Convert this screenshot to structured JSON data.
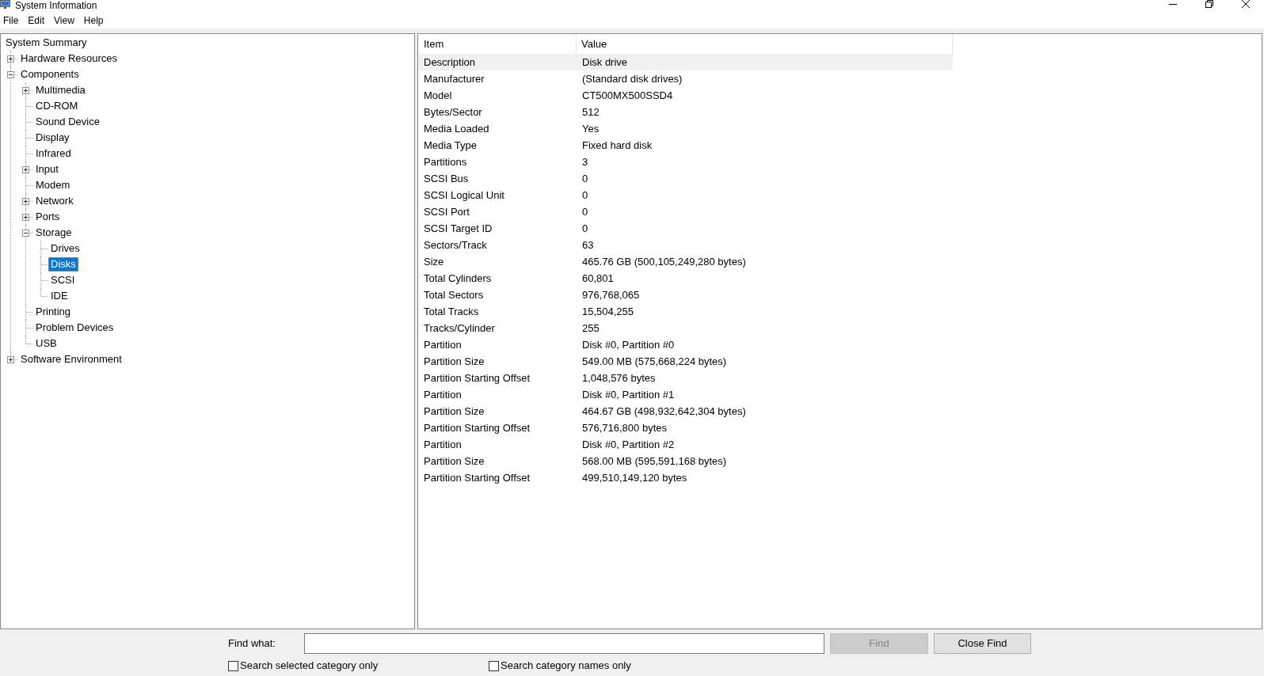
{
  "window": {
    "title": "System Information"
  },
  "menu": [
    "File",
    "Edit",
    "View",
    "Help"
  ],
  "tree": [
    {
      "label": "System Summary",
      "kind": "root",
      "selected": false,
      "children": [
        {
          "label": "Hardware Resources",
          "kind": "branch",
          "expanded": false,
          "selected": false
        },
        {
          "label": "Components",
          "kind": "branch",
          "expanded": true,
          "selected": false,
          "children": [
            {
              "label": "Multimedia",
              "kind": "branch",
              "expanded": false,
              "selected": false
            },
            {
              "label": "CD-ROM",
              "kind": "leaf",
              "selected": false
            },
            {
              "label": "Sound Device",
              "kind": "leaf",
              "selected": false
            },
            {
              "label": "Display",
              "kind": "leaf",
              "selected": false
            },
            {
              "label": "Infrared",
              "kind": "leaf",
              "selected": false
            },
            {
              "label": "Input",
              "kind": "branch",
              "expanded": false,
              "selected": false
            },
            {
              "label": "Modem",
              "kind": "leaf",
              "selected": false
            },
            {
              "label": "Network",
              "kind": "branch",
              "expanded": false,
              "selected": false
            },
            {
              "label": "Ports",
              "kind": "branch",
              "expanded": false,
              "selected": false
            },
            {
              "label": "Storage",
              "kind": "branch",
              "expanded": true,
              "selected": false,
              "children": [
                {
                  "label": "Drives",
                  "kind": "leaf",
                  "selected": false
                },
                {
                  "label": "Disks",
                  "kind": "leaf",
                  "selected": true
                },
                {
                  "label": "SCSI",
                  "kind": "leaf",
                  "selected": false
                },
                {
                  "label": "IDE",
                  "kind": "leaf",
                  "selected": false
                }
              ]
            },
            {
              "label": "Printing",
              "kind": "leaf",
              "selected": false
            },
            {
              "label": "Problem Devices",
              "kind": "leaf",
              "selected": false
            },
            {
              "label": "USB",
              "kind": "leaf",
              "selected": false
            }
          ]
        },
        {
          "label": "Software Environment",
          "kind": "branch",
          "expanded": false,
          "selected": false
        }
      ]
    }
  ],
  "table": {
    "columns": [
      "Item",
      "Value"
    ],
    "rows": [
      {
        "cells": [
          "Description",
          "Disk drive"
        ],
        "selected": true
      },
      {
        "cells": [
          "Manufacturer",
          "(Standard disk drives)"
        ],
        "selected": false
      },
      {
        "cells": [
          "Model",
          "CT500MX500SSD4"
        ],
        "selected": false
      },
      {
        "cells": [
          "Bytes/Sector",
          "512"
        ],
        "selected": false
      },
      {
        "cells": [
          "Media Loaded",
          "Yes"
        ],
        "selected": false
      },
      {
        "cells": [
          "Media Type",
          "Fixed hard disk"
        ],
        "selected": false
      },
      {
        "cells": [
          "Partitions",
          "3"
        ],
        "selected": false
      },
      {
        "cells": [
          "SCSI Bus",
          "0"
        ],
        "selected": false
      },
      {
        "cells": [
          "SCSI Logical Unit",
          "0"
        ],
        "selected": false
      },
      {
        "cells": [
          "SCSI Port",
          "0"
        ],
        "selected": false
      },
      {
        "cells": [
          "SCSI Target ID",
          "0"
        ],
        "selected": false
      },
      {
        "cells": [
          "Sectors/Track",
          "63"
        ],
        "selected": false
      },
      {
        "cells": [
          "Size",
          "465.76 GB (500,105,249,280 bytes)"
        ],
        "selected": false
      },
      {
        "cells": [
          "Total Cylinders",
          "60,801"
        ],
        "selected": false
      },
      {
        "cells": [
          "Total Sectors",
          "976,768,065"
        ],
        "selected": false
      },
      {
        "cells": [
          "Total Tracks",
          "15,504,255"
        ],
        "selected": false
      },
      {
        "cells": [
          "Tracks/Cylinder",
          "255"
        ],
        "selected": false
      },
      {
        "cells": [
          "Partition",
          "Disk #0, Partition #0"
        ],
        "selected": false
      },
      {
        "cells": [
          "Partition Size",
          "549.00 MB (575,668,224 bytes)"
        ],
        "selected": false
      },
      {
        "cells": [
          "Partition Starting Offset",
          "1,048,576 bytes"
        ],
        "selected": false
      },
      {
        "cells": [
          "Partition",
          "Disk #0, Partition #1"
        ],
        "selected": false
      },
      {
        "cells": [
          "Partition Size",
          "464.67 GB (498,932,642,304 bytes)"
        ],
        "selected": false
      },
      {
        "cells": [
          "Partition Starting Offset",
          "576,716,800 bytes"
        ],
        "selected": false
      },
      {
        "cells": [
          "Partition",
          "Disk #0, Partition #2"
        ],
        "selected": false
      },
      {
        "cells": [
          "Partition Size",
          "568.00 MB (595,591,168 bytes)"
        ],
        "selected": false
      },
      {
        "cells": [
          "Partition Starting Offset",
          "499,510,149,120 bytes"
        ],
        "selected": false
      }
    ]
  },
  "find_bar": {
    "label": "Find what:",
    "buttons": [
      {
        "label": "Find",
        "disabled": true
      },
      {
        "label": "Close Find",
        "disabled": false
      }
    ],
    "options": [
      {
        "label": "Search selected category only",
        "checked": false
      },
      {
        "label": "Search category names only",
        "checked": false
      }
    ]
  }
}
